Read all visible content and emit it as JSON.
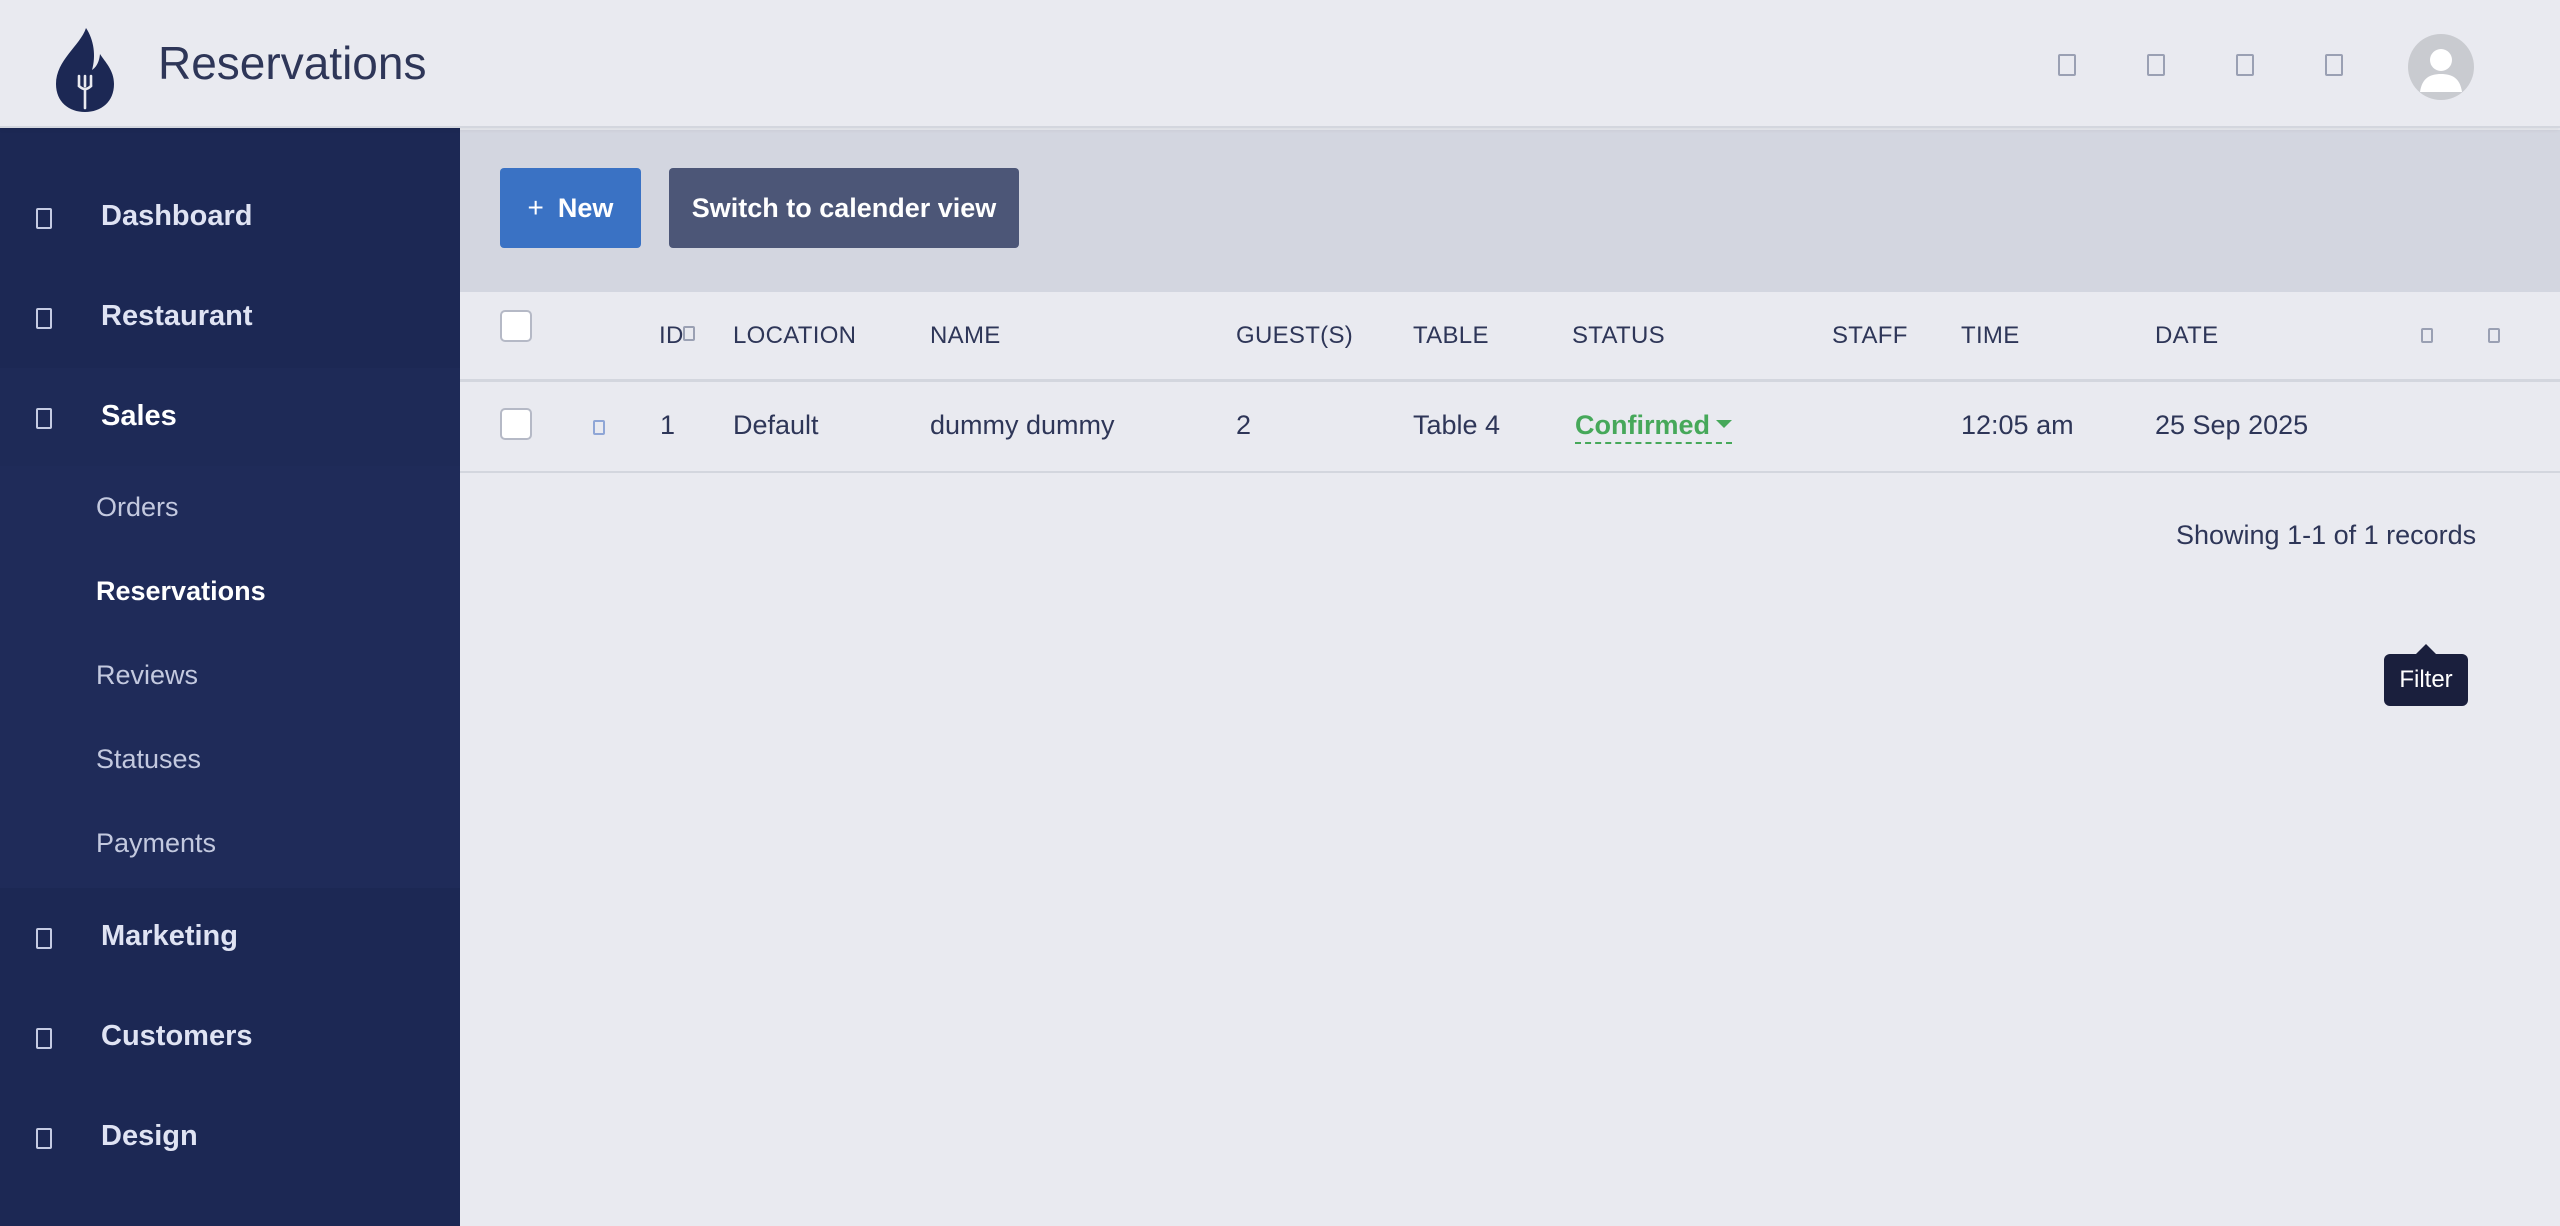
{
  "header": {
    "title": "Reservations",
    "logo_icon": "flame-fork-icon",
    "icons": [
      "notification-icon",
      "message-icon",
      "settings-icon",
      "help-icon"
    ],
    "avatar_icon": "user-avatar-icon"
  },
  "sidebar": {
    "items": [
      {
        "label": "Dashboard",
        "icon": "dashboard-icon"
      },
      {
        "label": "Restaurant",
        "icon": "restaurant-icon"
      },
      {
        "label": "Sales",
        "icon": "sales-icon"
      },
      {
        "label": "Marketing",
        "icon": "marketing-icon"
      },
      {
        "label": "Customers",
        "icon": "customers-icon"
      },
      {
        "label": "Design",
        "icon": "design-icon"
      }
    ],
    "sub_items": [
      {
        "label": "Orders"
      },
      {
        "label": "Reservations",
        "active": true
      },
      {
        "label": "Reviews"
      },
      {
        "label": "Statuses"
      },
      {
        "label": "Payments"
      }
    ]
  },
  "toolbar": {
    "new_plus": "+",
    "new_label": "New",
    "switch_label": "Switch to calender view"
  },
  "table": {
    "columns": {
      "id": "ID",
      "location": "LOCATION",
      "name": "NAME",
      "guests": "GUEST(S)",
      "table": "TABLE",
      "status": "STATUS",
      "staff": "STAFF",
      "time": "TIME",
      "date": "DATE"
    },
    "rows": [
      {
        "id": "1",
        "location": "Default",
        "name": "dummy dummy",
        "guests": "2",
        "table": "Table 4",
        "status": "Confirmed",
        "staff": "",
        "time": "12:05 am",
        "date": "25 Sep 2025"
      }
    ],
    "records_text": "Showing 1-1 of 1 records"
  },
  "tooltip": {
    "text": "Filter"
  },
  "colors": {
    "sidebar_bg": "#1c2854",
    "primary_button": "#3a72c4",
    "secondary_button": "#4c5677",
    "status_confirmed": "#46a85a",
    "page_bg": "#e9eaf0"
  }
}
